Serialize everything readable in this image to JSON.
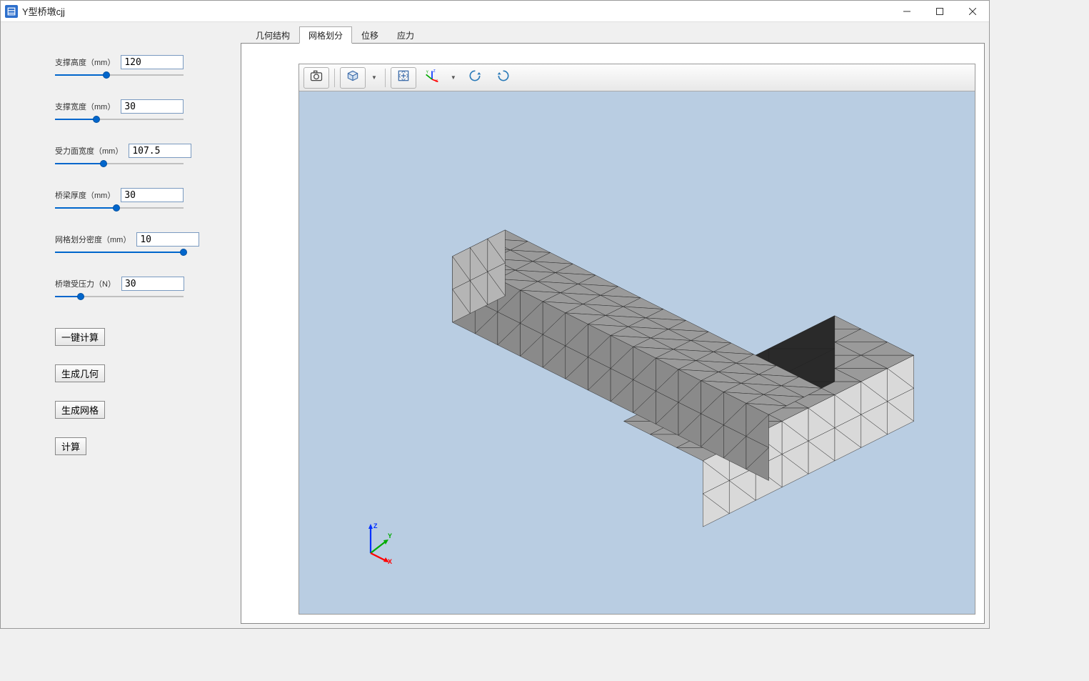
{
  "window": {
    "title": "Y型桥墩cjj"
  },
  "sidebar": {
    "params": [
      {
        "label": "支撑高度（mm）",
        "value": "120",
        "fill_pct": 40,
        "thumb_pct": 40
      },
      {
        "label": "支撑宽度（mm）",
        "value": "30",
        "fill_pct": 32,
        "thumb_pct": 32
      },
      {
        "label": "受力面宽度（mm）",
        "value": "107.5",
        "fill_pct": 38,
        "thumb_pct": 38
      },
      {
        "label": "桥梁厚度（mm）",
        "value": "30",
        "fill_pct": 48,
        "thumb_pct": 48
      },
      {
        "label": "网格划分密度（mm）",
        "value": "10",
        "fill_pct": 100,
        "thumb_pct": 100
      },
      {
        "label": "桥墩受压力（N）",
        "value": "30",
        "fill_pct": 20,
        "thumb_pct": 20
      }
    ],
    "buttons": {
      "one_click": "一键计算",
      "gen_geom": "生成几何",
      "gen_mesh": "生成网格",
      "compute": "计算"
    }
  },
  "tabs": {
    "items": [
      "几何结构",
      "网格划分",
      "位移",
      "应力"
    ],
    "active_index": 1
  },
  "toolbar": {
    "camera": "camera-icon",
    "cube": "cube-icon",
    "fit": "fit-screen-icon",
    "axes": "axes-icon",
    "rotate_cw": "rotate-cw-icon",
    "rotate_ccw": "rotate-ccw-icon"
  },
  "axes": {
    "x": "X",
    "y": "Y",
    "z": "Z"
  }
}
